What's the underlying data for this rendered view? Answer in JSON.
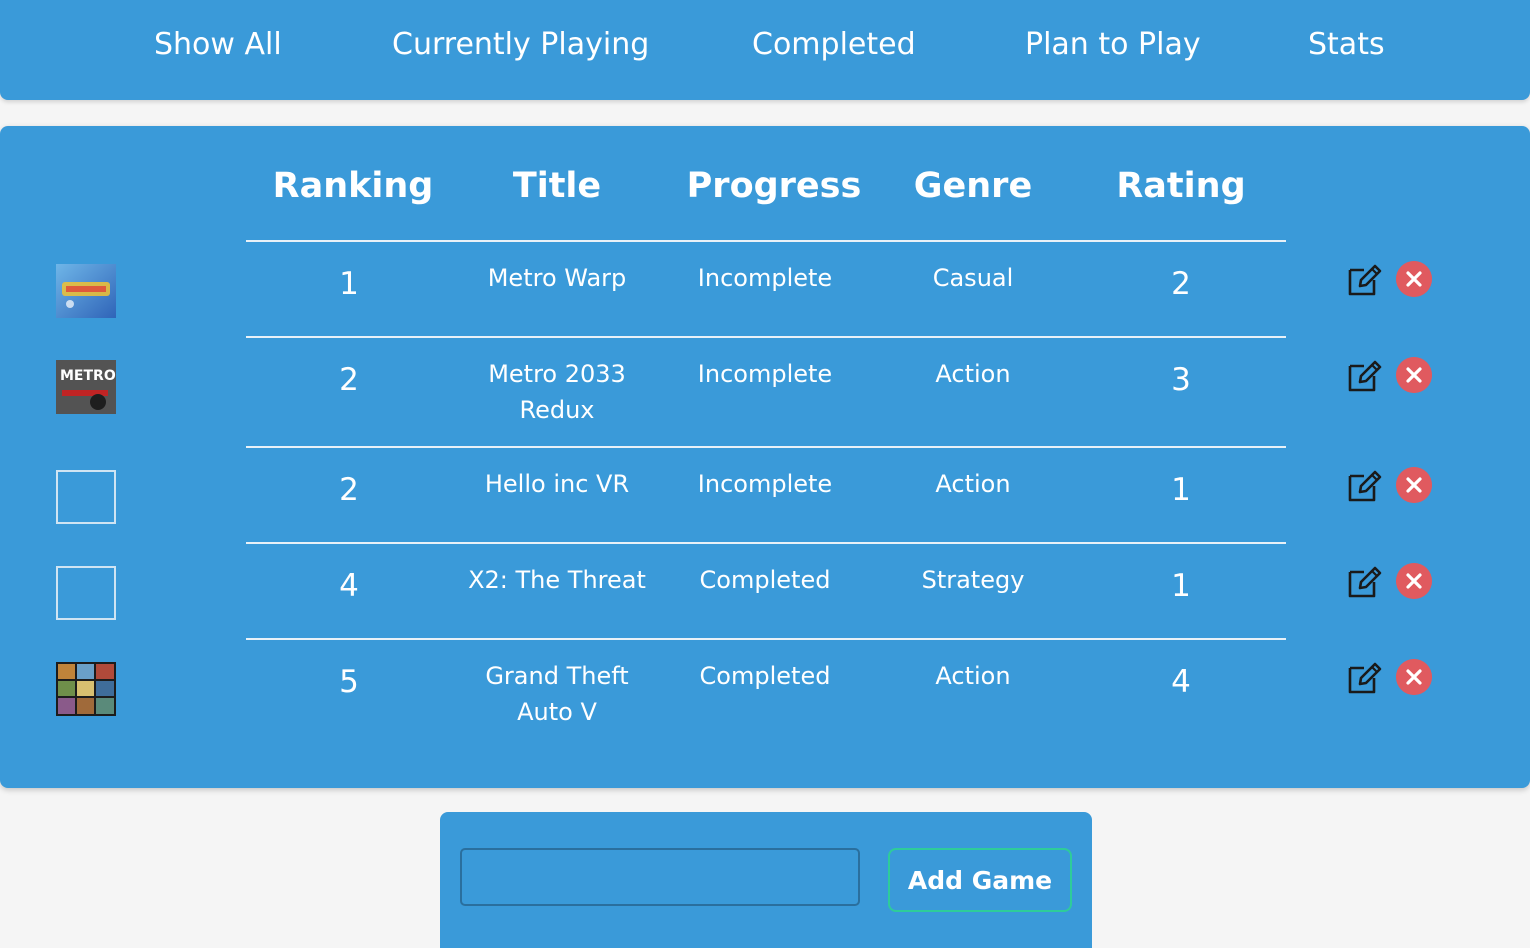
{
  "nav": {
    "items": [
      {
        "label": "Show All"
      },
      {
        "label": "Currently Playing"
      },
      {
        "label": "Completed"
      },
      {
        "label": "Plan to Play"
      },
      {
        "label": "Stats"
      }
    ]
  },
  "table": {
    "headers": [
      "Ranking",
      "Title",
      "Progress",
      "Genre",
      "Rating"
    ],
    "rows": [
      {
        "ranking": "1",
        "title": "Metro Warp",
        "progress": "Incomplete",
        "genre": "Casual",
        "rating": "2",
        "cover": "metro-warp-cover"
      },
      {
        "ranking": "2",
        "title": "Metro 2033 Redux",
        "progress": "Incomplete",
        "genre": "Action",
        "rating": "3",
        "cover": "metro-2033-cover"
      },
      {
        "ranking": "2",
        "title": "Hello inc VR",
        "progress": "Incomplete",
        "genre": "Action",
        "rating": "1",
        "cover": "empty"
      },
      {
        "ranking": "4",
        "title": "X2: The Threat",
        "progress": "Completed",
        "genre": "Strategy",
        "rating": "1",
        "cover": "empty"
      },
      {
        "ranking": "5",
        "title": "Grand Theft Auto V",
        "progress": "Completed",
        "genre": "Action",
        "rating": "4",
        "cover": "gta-v-cover"
      }
    ],
    "row_actions": {
      "edit_icon": "edit-icon",
      "delete_icon": "delete-icon"
    }
  },
  "add_form": {
    "input_value": "",
    "input_placeholder": "",
    "button_label": "Add Game"
  },
  "colors": {
    "primary": "#3a9ad9",
    "background": "#f5f5f5",
    "delete": "#e05a5f",
    "button_border": "#2ecc9a"
  }
}
